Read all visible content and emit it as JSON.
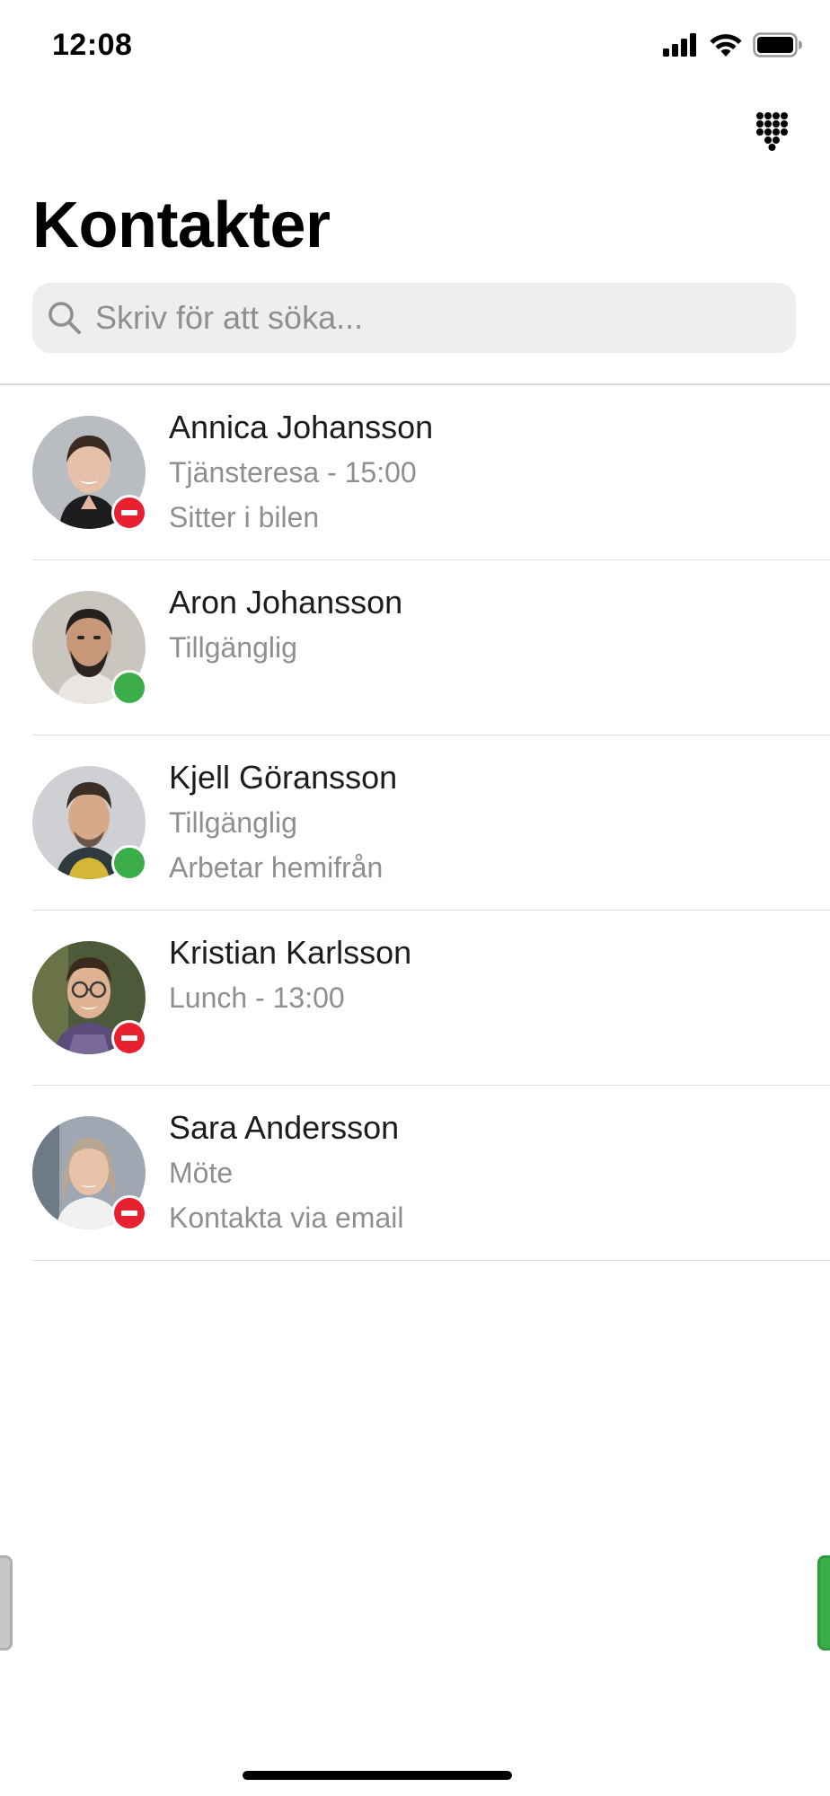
{
  "status_bar": {
    "time": "12:08"
  },
  "header": {
    "title": "Kontakter",
    "keypad_icon": "keypad-icon"
  },
  "search": {
    "placeholder": "Skriv för att söka...",
    "value": "",
    "icon": "search-icon"
  },
  "contacts": [
    {
      "name": "Annica Johansson",
      "status": "Tjänsteresa - 15:00",
      "note": "Sitter i bilen",
      "presence": "busy"
    },
    {
      "name": "Aron Johansson",
      "status": "Tillgänglig",
      "note": "",
      "presence": "available"
    },
    {
      "name": "Kjell Göransson",
      "status": "Tillgänglig",
      "note": "Arbetar hemifrån",
      "presence": "available"
    },
    {
      "name": "Kristian Karlsson",
      "status": "Lunch - 13:00",
      "note": "",
      "presence": "busy"
    },
    {
      "name": "Sara Andersson",
      "status": "Möte",
      "note": "Kontakta via email",
      "presence": "busy"
    }
  ],
  "colors": {
    "available": "#3aad48",
    "busy": "#e8202f",
    "secondary_text": "#8e8e93",
    "search_background": "#eeeeef"
  }
}
